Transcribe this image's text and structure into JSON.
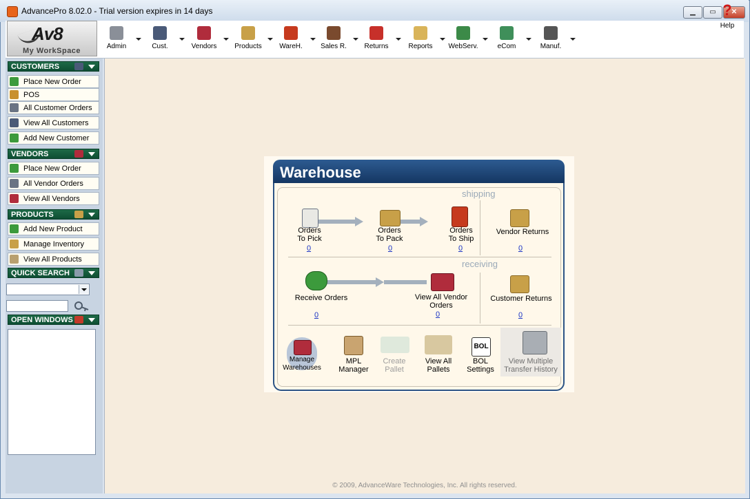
{
  "window": {
    "title": "AdvancePro 8.02.0 - Trial version expires in 14 days",
    "min_label": "▁",
    "max_label": "▭",
    "close_label": "✕"
  },
  "logo": {
    "main": "Av8",
    "sub": "My WorkSpace"
  },
  "toolbar": {
    "items": [
      {
        "label": "Admin",
        "icon": "admin-computer-icon",
        "color": "#8a8f98"
      },
      {
        "label": "Cust.",
        "icon": "customer-person-icon",
        "color": "#4a5a78"
      },
      {
        "label": "Vendors",
        "icon": "vendor-factory-icon",
        "color": "#b02c3c"
      },
      {
        "label": "Products",
        "icon": "product-box-icon",
        "color": "#c8a048"
      },
      {
        "label": "WareH.",
        "icon": "warehouse-handtruck-icon",
        "color": "#c63a1e"
      },
      {
        "label": "Sales R.",
        "icon": "sales-rep-icon",
        "color": "#7a4a2e"
      },
      {
        "label": "Returns",
        "icon": "returns-arrow-icon",
        "color": "#c7302a"
      },
      {
        "label": "Reports",
        "icon": "reports-document-icon",
        "color": "#d9b45a"
      },
      {
        "label": "WebServ.",
        "icon": "web-services-icon",
        "color": "#3c8a48"
      },
      {
        "label": "eCom",
        "icon": "ecommerce-dollar-icon",
        "color": "#3f8f5a"
      },
      {
        "label": "Manuf.",
        "icon": "manufacturing-gears-icon",
        "color": "#555555"
      }
    ],
    "help_label": "Help",
    "help_glyph": "?"
  },
  "sidebar": {
    "customers": {
      "title": "CUSTOMERS",
      "items": [
        {
          "label": "Place New Order",
          "color": "#3c9a3c"
        },
        {
          "label": "POS",
          "color": "#c8902e"
        },
        {
          "label": "All Customer Orders",
          "color": "#6a7484"
        },
        {
          "label": "View All Customers",
          "color": "#4a5a78"
        },
        {
          "label": "Add New Customer",
          "color": "#3c9a3c"
        }
      ]
    },
    "vendors": {
      "title": "VENDORS",
      "items": [
        {
          "label": "Place New Order",
          "color": "#3c9a3c"
        },
        {
          "label": "All Vendor Orders",
          "color": "#6a7484"
        },
        {
          "label": "View All Vendors",
          "color": "#b02c3c"
        }
      ]
    },
    "products": {
      "title": "PRODUCTS",
      "items": [
        {
          "label": "Add New Product",
          "color": "#3c9a3c"
        },
        {
          "label": "Manage Inventory",
          "color": "#c8a048"
        },
        {
          "label": "View All Products",
          "color": "#b8a070"
        }
      ]
    },
    "quick_search": {
      "title": "QUICK SEARCH",
      "select_value": "",
      "input_value": ""
    },
    "open_windows": {
      "title": "OPEN WINDOWS"
    }
  },
  "warehouse": {
    "title": "Warehouse",
    "shipping_label": "shipping",
    "receiving_label": "receiving",
    "orders_to_pick": {
      "line1": "Orders",
      "line2": "To Pick",
      "count": "0"
    },
    "orders_to_pack": {
      "line1": "Orders",
      "line2": "To Pack",
      "count": "0"
    },
    "orders_to_ship": {
      "line1": "Orders",
      "line2": "To Ship",
      "count": "0"
    },
    "vendor_returns": {
      "label": "Vendor Returns",
      "count": "0"
    },
    "receive_orders": {
      "label": "Receive Orders",
      "count": "0"
    },
    "view_all_vendor_orders": {
      "line1": "View All Vendor",
      "line2": "Orders",
      "count": "0"
    },
    "customer_returns": {
      "label": "Customer Returns",
      "count": "0"
    },
    "tools": {
      "manage_warehouses": {
        "line1": "Manage",
        "line2": "Warehouses"
      },
      "mpl_manager": {
        "line1": "MPL",
        "line2": "Manager"
      },
      "create_pallet": {
        "line1": "Create",
        "line2": "Pallet"
      },
      "view_all_pallets": {
        "line1": "View All",
        "line2": "Pallets"
      },
      "bol_settings": {
        "line1": "BOL",
        "line2": "Settings",
        "glyph": "BOL"
      },
      "view_multiple_transfer_history": {
        "line1": "View Multiple",
        "line2": "Transfer History"
      }
    }
  },
  "footer": {
    "copyright": "© 2009, AdvanceWare Technologies, Inc. All rights reserved."
  }
}
